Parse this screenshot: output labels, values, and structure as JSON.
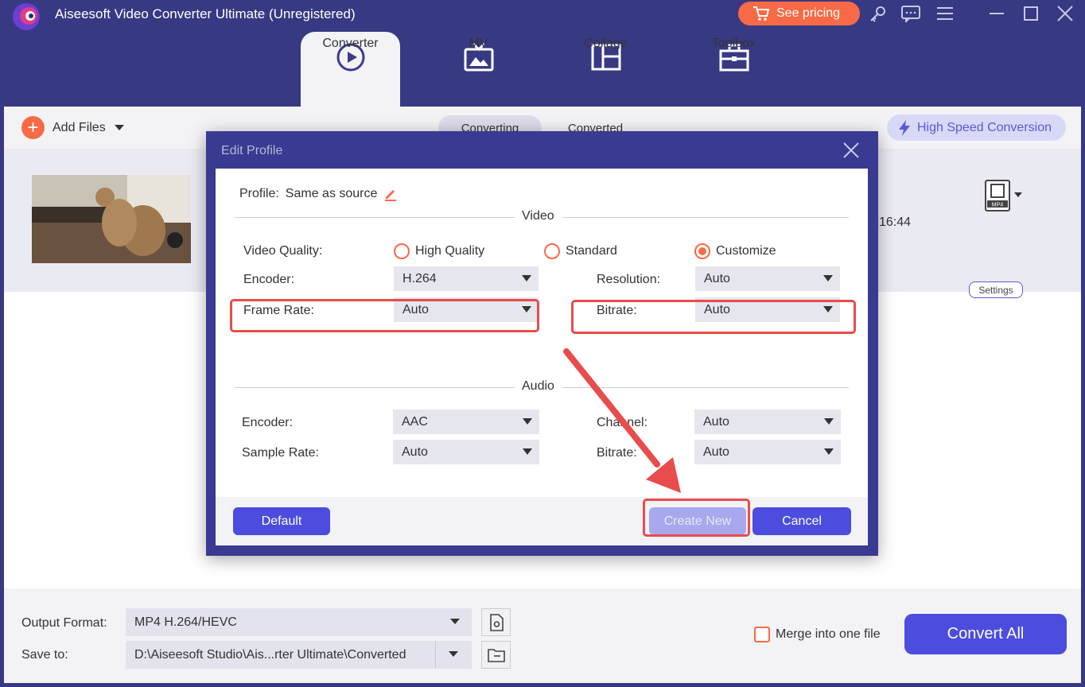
{
  "app": {
    "title": "Aiseesoft Video Converter Ultimate (Unregistered)",
    "pricing_label": "See pricing",
    "accent_color": "#f86a46",
    "primary_color": "#4c4cde",
    "header_color": "#383983"
  },
  "tabs": [
    {
      "label": "Converter",
      "icon": "converter-icon",
      "active": true
    },
    {
      "label": "MV",
      "icon": "tv-icon"
    },
    {
      "label": "Collage",
      "icon": "collage-icon"
    },
    {
      "label": "Toolbox",
      "icon": "toolbox-icon"
    }
  ],
  "toolbar": {
    "add_files": "Add Files",
    "segment_converting": "Converting",
    "segment_converted": "Converted",
    "high_speed": "High Speed Conversion"
  },
  "file_row": {
    "duration_fragment": "16:44",
    "format_badge": "MP4",
    "settings_label": "Settings"
  },
  "bottom": {
    "output_format_label": "Output Format:",
    "output_format_value": "MP4 H.264/HEVC",
    "save_to_label": "Save to:",
    "save_to_value": "D:\\Aiseesoft Studio\\Ais...rter Ultimate\\Converted",
    "merge_label": "Merge into one file",
    "convert_all": "Convert All"
  },
  "dialog": {
    "title": "Edit Profile",
    "profile_label": "Profile:",
    "profile_value": "Same as source",
    "video_section": "Video",
    "audio_section": "Audio",
    "video_quality_label": "Video Quality:",
    "quality_options": [
      "High Quality",
      "Standard",
      "Customize"
    ],
    "quality_selected": "Customize",
    "video_encoder_label": "Encoder:",
    "video_encoder_value": "H.264",
    "resolution_label": "Resolution:",
    "resolution_value": "Auto",
    "frame_rate_label": "Frame Rate:",
    "frame_rate_value": "Auto",
    "video_bitrate_label": "Bitrate:",
    "video_bitrate_value": "Auto",
    "audio_encoder_label": "Encoder:",
    "audio_encoder_value": "AAC",
    "channel_label": "Channel:",
    "channel_value": "Auto",
    "sample_rate_label": "Sample Rate:",
    "sample_rate_value": "Auto",
    "audio_bitrate_label": "Bitrate:",
    "audio_bitrate_value": "Auto",
    "default_btn": "Default",
    "create_new_btn": "Create New",
    "cancel_btn": "Cancel"
  },
  "annotation_color": "#e84c4c"
}
